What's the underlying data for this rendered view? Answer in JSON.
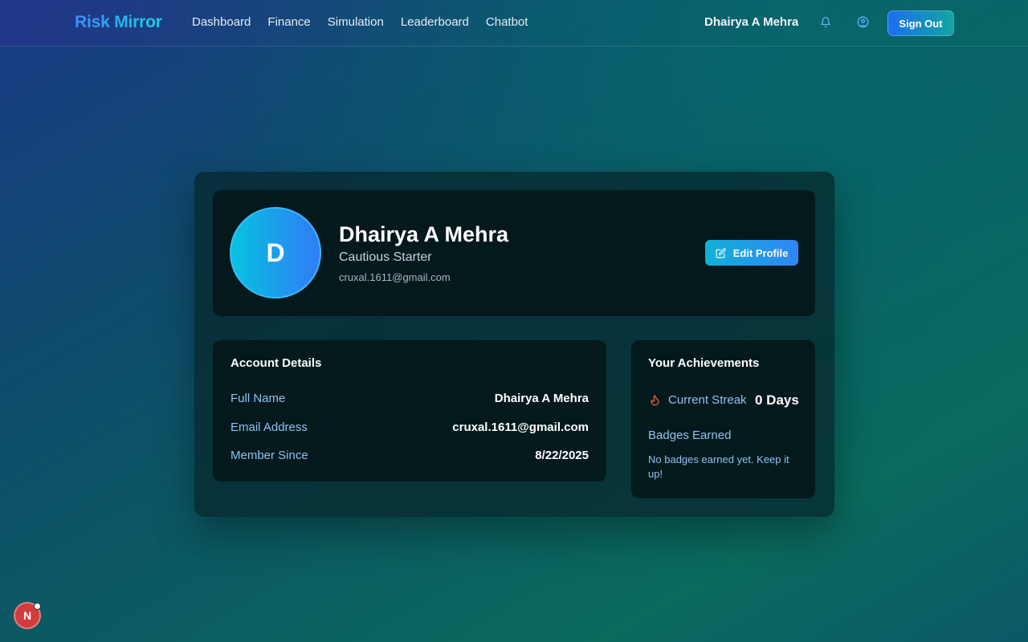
{
  "navbar": {
    "logo": "Risk Mirror",
    "links": [
      "Dashboard",
      "Finance",
      "Simulation",
      "Leaderboard",
      "Chatbot"
    ],
    "user_name": "Dhairya A Mehra",
    "icons": [
      "bell-icon",
      "user-circle-icon"
    ],
    "sign_out_label": "Sign Out"
  },
  "profile": {
    "avatar_initial": "D",
    "name": "Dhairya A Mehra",
    "role": "Cautious Starter",
    "email": "cruxal.1611@gmail.com",
    "edit_label": "Edit Profile"
  },
  "account_details": {
    "title": "Account Details",
    "rows": [
      {
        "label": "Full Name",
        "value": "Dhairya A Mehra"
      },
      {
        "label": "Email Address",
        "value": "cruxal.1611@gmail.com"
      },
      {
        "label": "Member Since",
        "value": "8/22/2025"
      }
    ]
  },
  "achievements": {
    "title": "Your Achievements",
    "streak_label": "Current Streak",
    "streak_value": "0 Days",
    "badges_label": "Badges Earned",
    "badges_empty": "No badges earned yet. Keep it up!"
  },
  "dev_badge": {
    "label": "N"
  },
  "colors": {
    "accent_blue": "#2f86f4",
    "accent_cyan": "#12b0d8",
    "label_blue": "#8fc2f2",
    "card_bg": "#03191c",
    "streak_orange": "#f26b2a"
  }
}
